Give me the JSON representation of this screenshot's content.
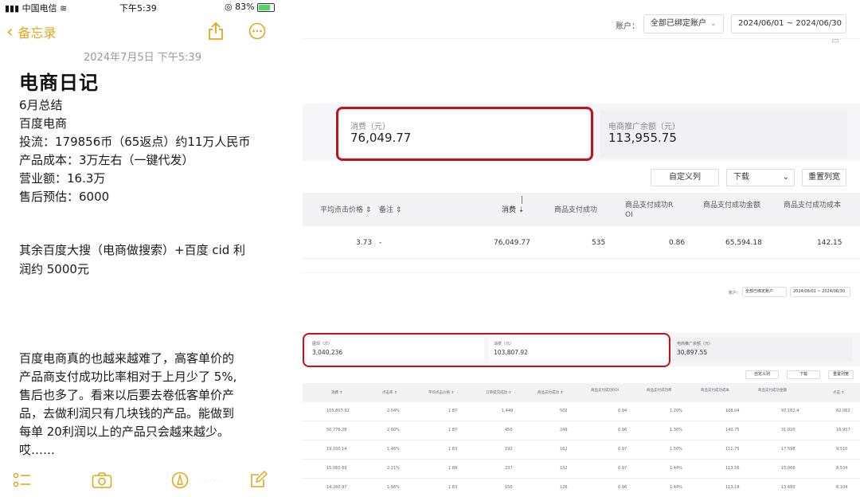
{
  "phone": {
    "status": {
      "carrier": "中国电信",
      "time": "下午5:39",
      "battery": "83%"
    },
    "nav": {
      "back_label": "备忘录"
    },
    "note": {
      "date": "2024年7月5日 下午5:39",
      "title": "电商日记",
      "lines": [
        "6月总结",
        "百度电商",
        "投流：179856币（65返点）约11万人民币",
        "产品成本：3万左右（一键代发）",
        "营业额：16.3万",
        "售后预估：6000",
        "其余百度大搜（电商做搜索）+百度 cid 利",
        "润约 5000元",
        "百度电商真的也越来越难了，高客单价的",
        "产品商支付成功比率相对于上月少了 5%,",
        "售后也多了。看来以后要去卷低客单价产",
        "品，去做利润只有几块钱的产品。能做到",
        "每单 20利润以上的产品只会越来越少。",
        "哎……"
      ]
    }
  },
  "dash1": {
    "account_label": "账户：",
    "account_value": "全部已绑定账户",
    "date_range": "2024/06/01 ~ 2024/06/30",
    "kpi": [
      {
        "label": "消费（元）",
        "value": "76,049.77"
      },
      {
        "label": "电商推广余额（元）",
        "value": "113,955.75"
      }
    ],
    "buttons": {
      "custom_cols": "自定义列",
      "download": "下载",
      "reset_cols": "重置列宽"
    },
    "headers": [
      "平均点击价格 ⇕",
      "备注 ⇕",
      "消费 ⇣",
      "商品支付成功",
      "商品支付成功R OI",
      "商品支付成功金额",
      "商品支付成功成本"
    ],
    "row": [
      "3.73",
      "-",
      "76,049.77",
      "535",
      "0.86",
      "65,594.18",
      "142.15"
    ]
  },
  "dash2": {
    "account_label": "账户：",
    "account_value": "全部已绑定账户",
    "date_range": "2024/06/01 ~ 2024/06/30",
    "kpi": [
      {
        "label": "展现（次）",
        "value": "3,040,236"
      },
      {
        "label": "消费（元）",
        "value": "103,807.92"
      },
      {
        "label": "电商推广余额（元）",
        "value": "30,897.55"
      }
    ],
    "buttons": {
      "custom_cols": "自定义列",
      "download": "下载",
      "reset_cols": "重置列宽"
    },
    "headers": [
      "消费 ⇕",
      "点击率 ⇕",
      "平均点击价格 ⇕",
      "订单提交成功 ⇕",
      "商品支付成功 ⇕",
      "商品支付成功ROI",
      "商品支付成功率",
      "商品支付成功成本",
      "商品支付成功金额",
      "点击 ⇕"
    ],
    "rows": [
      [
        "105,807.92",
        "2.04%",
        "1.87",
        "1,449",
        "502",
        "0.94",
        "1.20%",
        "108.04",
        "97,162.4",
        "62,062"
      ],
      [
        "50,776.28",
        "2.60%",
        "1.87",
        "450",
        "249",
        "0.96",
        "1.30%",
        "140.75",
        "31,020",
        "16,957"
      ],
      [
        "19,100.14",
        "1.46%",
        "1.83",
        "192",
        "162",
        "0.97",
        "1.50%",
        "111.75",
        "17,598",
        "9,510"
      ],
      [
        "15,060.69",
        "2.21%",
        "1.89",
        "237",
        "132",
        "0.97",
        "1.44%",
        "113.56",
        "15,066",
        "8,534"
      ],
      [
        "14,260.97",
        "1.66%",
        "1.83",
        "150",
        "126",
        "0.96",
        "1.44%",
        "113.18",
        "13,680",
        "8,104"
      ]
    ]
  }
}
